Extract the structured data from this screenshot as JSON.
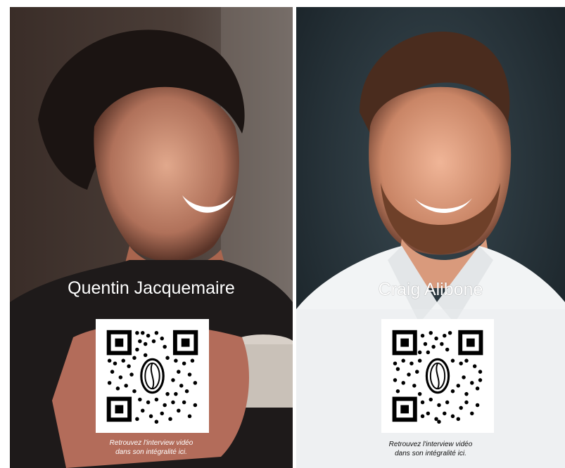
{
  "profiles": [
    {
      "name": "Quentin Jacquemaire",
      "caption_line1": "Retrouvez l'interview vidéo",
      "caption_line2": "dans son intégralité ici."
    },
    {
      "name": "Craig Alibone",
      "caption_line1": "Retrouvez l'interview vidéo",
      "caption_line2": "dans son intégralité ici."
    }
  ],
  "colors": {
    "left_background": "#2a211e",
    "right_background": "#1f2a30",
    "qr_foreground": "#000000"
  },
  "icons": [
    "qr-code-icon",
    "coffee-bean-icon"
  ]
}
